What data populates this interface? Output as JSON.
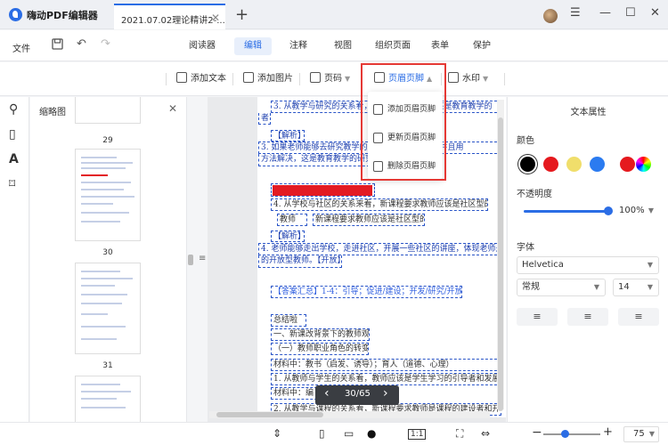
{
  "app": {
    "name": "嗨动PDF编辑器"
  },
  "tab": {
    "title": "2021.07.02理论精讲2-...",
    "close": "✕"
  },
  "window": {
    "new_tab": "+",
    "menu": "☰",
    "minimize": "—",
    "maximize": "☐",
    "close": "✕"
  },
  "menubar": {
    "file": "文件",
    "modes": [
      {
        "label": "阅读器",
        "active": false
      },
      {
        "label": "编辑",
        "active": true
      },
      {
        "label": "注释",
        "active": false
      },
      {
        "label": "视图",
        "active": false
      },
      {
        "label": "组织页面",
        "active": false
      },
      {
        "label": "表单",
        "active": false
      },
      {
        "label": "保护",
        "active": false
      }
    ]
  },
  "toolbar": {
    "add_text": "添加文本",
    "add_image": "添加图片",
    "page_number": "页码",
    "header_footer": "页眉页脚",
    "watermark": "水印"
  },
  "dropdown": {
    "add": "添加页眉页脚",
    "update": "更新页眉页脚",
    "delete": "删除页眉页脚"
  },
  "thumbnails": {
    "title": "缩略图",
    "close": "✕",
    "pages": [
      "29",
      "30",
      "31"
    ]
  },
  "document": {
    "lines": [
      "3. 从教学与研究的关系看，新课程要求教师应该是教育教学的",
      "者",
      "【解析】",
      "3. 如果老师能够去研究教学的过程中遇到的问题，并且用",
      "方法解决，这是教育教学的研究者。",
      "4. 从学校与社区的关系来看，新课程要求教师应该是社区型的",
      "教师",
      "新课程要求教师应该是社区型的",
      "【解析】",
      "4. 老师能够走出学校，走进社区，开展一些社区的讲座，体现老师是",
      "的开放型教师。【开放】",
      "【答案汇总】1-4：引导；促进/建设；开发/研究/开放",
      "总结啦",
      "一、新课改背景下的教师观",
      "（一）教师职业角色的转变",
      "材料中：教书（启发、诱导）；育人（道德、心理）",
      "1. 从教师与学生的关系看，教师应该是学生学习的引导者和发展的促",
      "材料中：编",
      "课程",
      "2. 从教学与课程的关系看，新课程要求教师是课程的建设者和开发者"
    ]
  },
  "pager": {
    "prev": "‹",
    "current": "30/65",
    "next": "›"
  },
  "properties": {
    "title": "文本属性",
    "color_label": "颜色",
    "colors": [
      "#000000",
      "#e5191e",
      "#f0de6b",
      "#2b7bf0",
      "#e5191e"
    ],
    "opacity_label": "不透明度",
    "opacity": "100%",
    "opacity_value": 1.0,
    "font_label": "字体",
    "font": "Helvetica",
    "style": "常规",
    "size": "14"
  },
  "statusbar": {
    "fit_page": "1:1",
    "zoom": "75",
    "zoom_value": 0.75
  }
}
